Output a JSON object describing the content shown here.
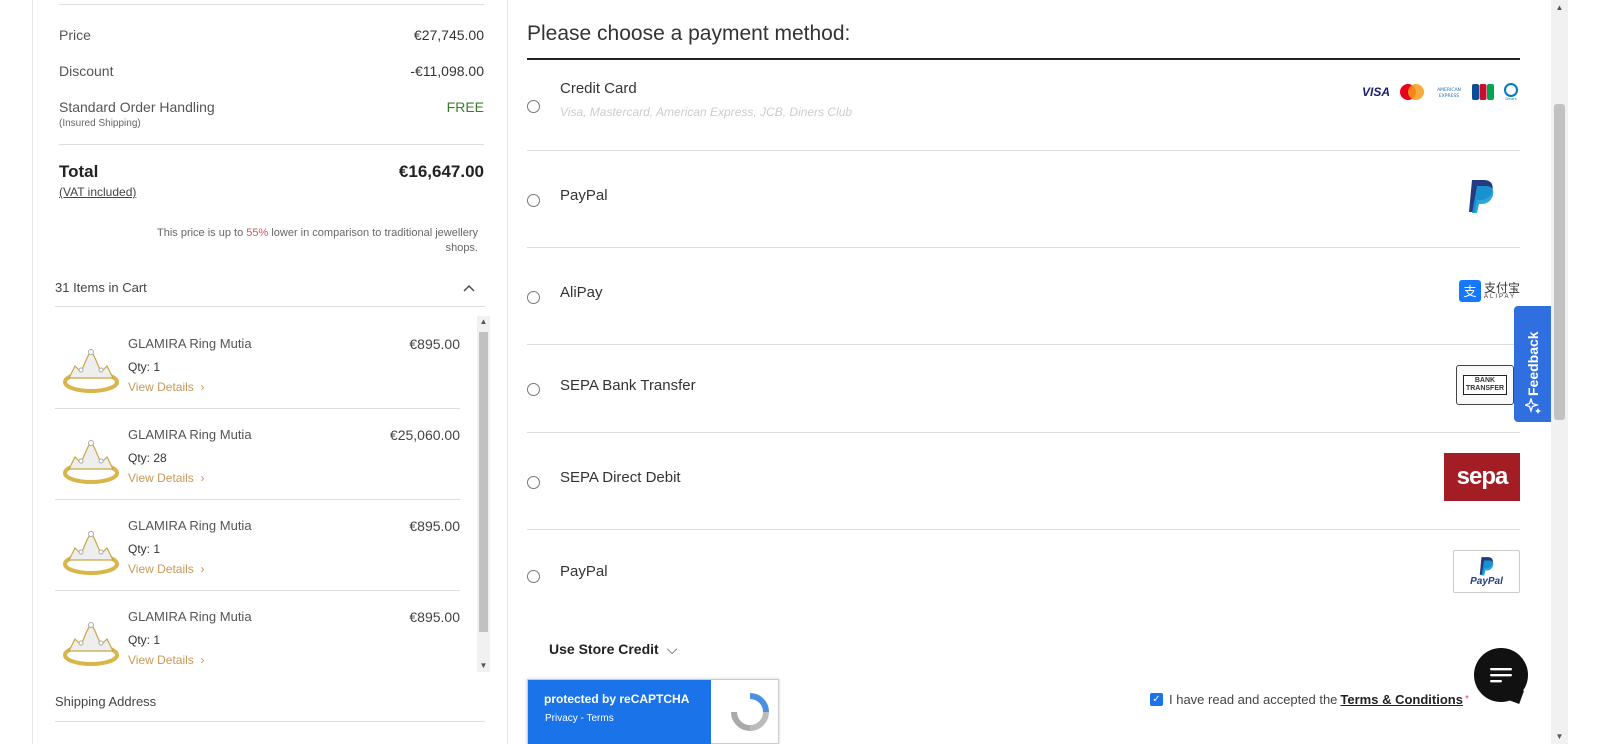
{
  "summary": {
    "price_label": "Price",
    "price_value": "€27,745.00",
    "discount_label": "Discount",
    "discount_value": "-€11,098.00",
    "handling_label": "Standard Order Handling",
    "handling_sub": "(Insured Shipping)",
    "handling_value": "FREE",
    "total_label": "Total",
    "total_value": "€16,647.00",
    "vat_label": "(VAT included)",
    "compare_pre": "This price is up to ",
    "compare_pct": "55%",
    "compare_post": " lower in comparison to traditional jewellery shops."
  },
  "cart": {
    "header": "31 Items in Cart",
    "toggle_icon": "chevron-up-icon",
    "items": [
      {
        "name": "GLAMIRA Ring Mutia",
        "price": "€895.00",
        "qty": "Qty: 1",
        "link": "View Details"
      },
      {
        "name": "GLAMIRA Ring Mutia",
        "price": "€25,060.00",
        "qty": "Qty: 28",
        "link": "View Details"
      },
      {
        "name": "GLAMIRA Ring Mutia",
        "price": "€895.00",
        "qty": "Qty: 1",
        "link": "View Details"
      },
      {
        "name": "GLAMIRA Ring Mutia",
        "price": "€895.00",
        "qty": "Qty: 1",
        "link": "View Details"
      }
    ],
    "shipping_label": "Shipping Address"
  },
  "payment": {
    "title": "Please choose a payment method:",
    "methods": [
      {
        "label": "Credit Card",
        "hint": "Visa, Mastercard, American Express, JCB, Diners Club",
        "logo": "card-brands-icon"
      },
      {
        "label": "PayPal",
        "logo": "paypal-icon"
      },
      {
        "label": "AliPay",
        "logo": "alipay-icon",
        "logo_text": "支付宝",
        "logo_sub": "ALIPAY"
      },
      {
        "label": "SEPA Bank Transfer",
        "logo": "bank-transfer-icon",
        "logo_text": "BANK TRANSFER"
      },
      {
        "label": "SEPA Direct Debit",
        "logo": "sepa-icon",
        "logo_text": "sepa"
      },
      {
        "label": "PayPal",
        "logo": "paypal-boxed-icon",
        "logo_text": "PayPal"
      }
    ],
    "card_brands": [
      "VISA",
      "MC",
      "AMEX",
      "JCB",
      "DC"
    ],
    "store_credit": "Use Store Credit"
  },
  "recaptcha": {
    "line1": "protected by reCAPTCHA",
    "line2": "Privacy - Terms"
  },
  "terms": {
    "text": "I have read and accepted the",
    "link": "Terms & Conditions",
    "required": "*"
  },
  "feedback": {
    "label": "Feedback"
  },
  "colors": {
    "accent": "#1a73e8",
    "free": "#3a7d2c",
    "highlight": "#e0505a",
    "link_gold": "#c8985a",
    "sepa_red": "#a31d24"
  }
}
